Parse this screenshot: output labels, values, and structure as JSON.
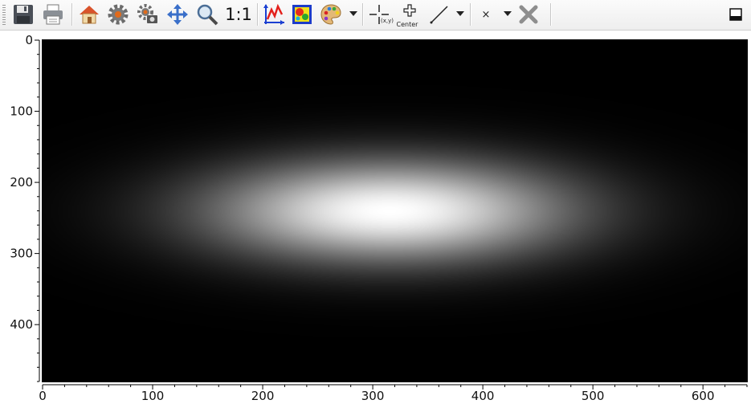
{
  "toolbar": {
    "buttons": [
      {
        "name": "save-button",
        "icon": "save-icon"
      },
      {
        "name": "print-button",
        "icon": "print-icon"
      },
      {
        "name": "home-button",
        "icon": "home-icon"
      },
      {
        "name": "settings-button",
        "icon": "gear-icon"
      },
      {
        "name": "camera-settings-button",
        "icon": "camera-gear-icon"
      },
      {
        "name": "pan-button",
        "icon": "move-arrows-icon"
      },
      {
        "name": "zoom-button",
        "icon": "magnifier-icon"
      },
      {
        "name": "aspect-ratio-button",
        "label": "1:1"
      },
      {
        "name": "profile-button",
        "icon": "line-profile-icon"
      },
      {
        "name": "colormap-image-button",
        "icon": "colormap-image-icon"
      },
      {
        "name": "colormap-palette-button",
        "icon": "palette-icon"
      },
      {
        "name": "crosshair-xy-button",
        "icon": "crosshair-xy-icon",
        "label": "(x,y)"
      },
      {
        "name": "center-button",
        "icon": "center-cross-icon",
        "label": "Center"
      },
      {
        "name": "line-tool-button",
        "icon": "line-icon"
      },
      {
        "name": "marker-button",
        "icon": "x-marker-icon",
        "label": "×"
      },
      {
        "name": "clear-button",
        "icon": "clear-x-icon"
      },
      {
        "name": "dock-button",
        "icon": "dock-window-icon"
      }
    ]
  },
  "plot": {
    "background": "#000000",
    "x_ticks": [
      "0",
      "100",
      "200",
      "300",
      "400",
      "500",
      "600"
    ],
    "y_ticks": [
      "0",
      "100",
      "200",
      "300",
      "400"
    ],
    "x_range": [
      0,
      640
    ],
    "y_range": [
      0,
      480
    ],
    "y_inverted": true,
    "colormap": "gray",
    "blob": {
      "center_x": 315,
      "center_y": 240,
      "sigma_x": 110,
      "sigma_y": 48
    }
  }
}
